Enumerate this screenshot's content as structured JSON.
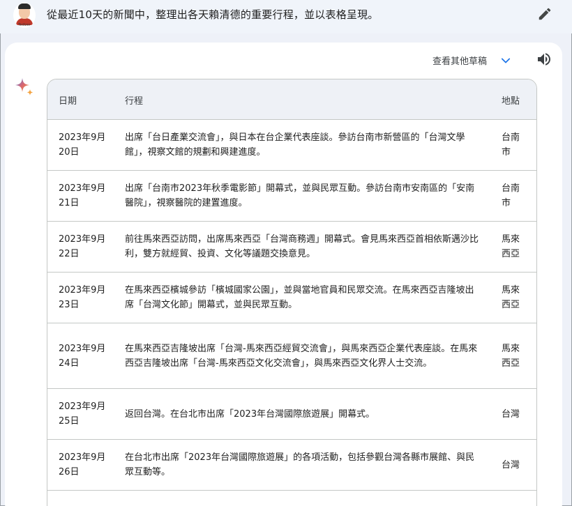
{
  "prompt": {
    "avatar_tag": "Tedizer",
    "text": "從最近10天的新聞中，整理出各天賴清德的重要行程，並以表格呈現。"
  },
  "response": {
    "drafts_label": "查看其他草稿"
  },
  "table": {
    "headers": {
      "date": "日期",
      "schedule": "行程",
      "place": "地點"
    },
    "rows": [
      {
        "date": "2023年9月20日",
        "schedule": "出席「台日產業交流會」，與日本在台企業代表座談。參訪台南市新營區的「台灣文學館」，視察文館的規劃和興建進度。",
        "place": "台南市"
      },
      {
        "date": "2023年9月21日",
        "schedule": "出席「台南市2023年秋季電影節」開幕式，並與民眾互動。參訪台南市安南區的「安南醫院」，視察醫院的建置進度。",
        "place": "台南市"
      },
      {
        "date": "2023年9月22日",
        "schedule": "前往馬來西亞訪問，出席馬來西亞「台灣商務週」開幕式。會見馬來西亞首相依斯邁沙比利，雙方就經貿、投資、文化等議題交換意見。",
        "place": "馬來西亞"
      },
      {
        "date": "2023年9月23日",
        "schedule": "在馬來西亞檳城參訪「檳城國家公園」，並與當地官員和民眾交流。在馬來西亞吉隆坡出席「台灣文化節」開幕式，並與民眾互動。",
        "place": "馬來西亞"
      },
      {
        "date": "2023年9月24日",
        "schedule": "在馬來西亞吉隆坡出席「台灣-馬來西亞經貿交流會」，與馬來西亞企業代表座談。在馬來西亞吉隆坡出席「台灣-馬來西亞文化交流會」，與馬來西亞文化界人士交流。",
        "place": "馬來西亞"
      },
      {
        "date": "2023年9月25日",
        "schedule": "返回台灣。在台北市出席「2023年台灣國際旅遊展」開幕式。",
        "place": "台灣"
      },
      {
        "date": "2023年9月26日",
        "schedule": "在台北市出席「2023年台灣國際旅遊展」的各項活動，包括參觀台灣各縣市展館、與民眾互動等。",
        "place": "台灣"
      }
    ]
  },
  "icons": {
    "edit": "pencil-icon",
    "drafts": "chevron-down-icon",
    "speak": "speaker-icon",
    "assistant": "sparkle-icon"
  },
  "colors": {
    "page_bg": "#eef1f8",
    "card_bg": "#ffffff",
    "header_bg": "#eef1f6",
    "accent_blue": "#1a73e8",
    "sparkle_blue": "#4285f4",
    "sparkle_orange": "#f4a340"
  }
}
